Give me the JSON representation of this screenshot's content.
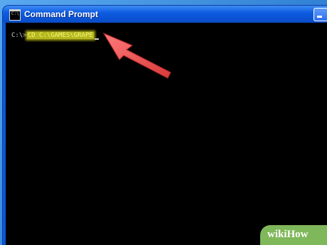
{
  "window": {
    "title": "Command Prompt",
    "icon": "command-prompt-icon",
    "icon_text": "C:\\"
  },
  "console": {
    "prompt": "C:\\>",
    "command": "CD C:\\GAMES\\GRAPE",
    "highlight_color": "#b6b61e"
  },
  "annotation": {
    "arrow_color": "#f05454",
    "icon": "red-arrow-pointer"
  },
  "watermark": {
    "text": "wikiHow"
  }
}
